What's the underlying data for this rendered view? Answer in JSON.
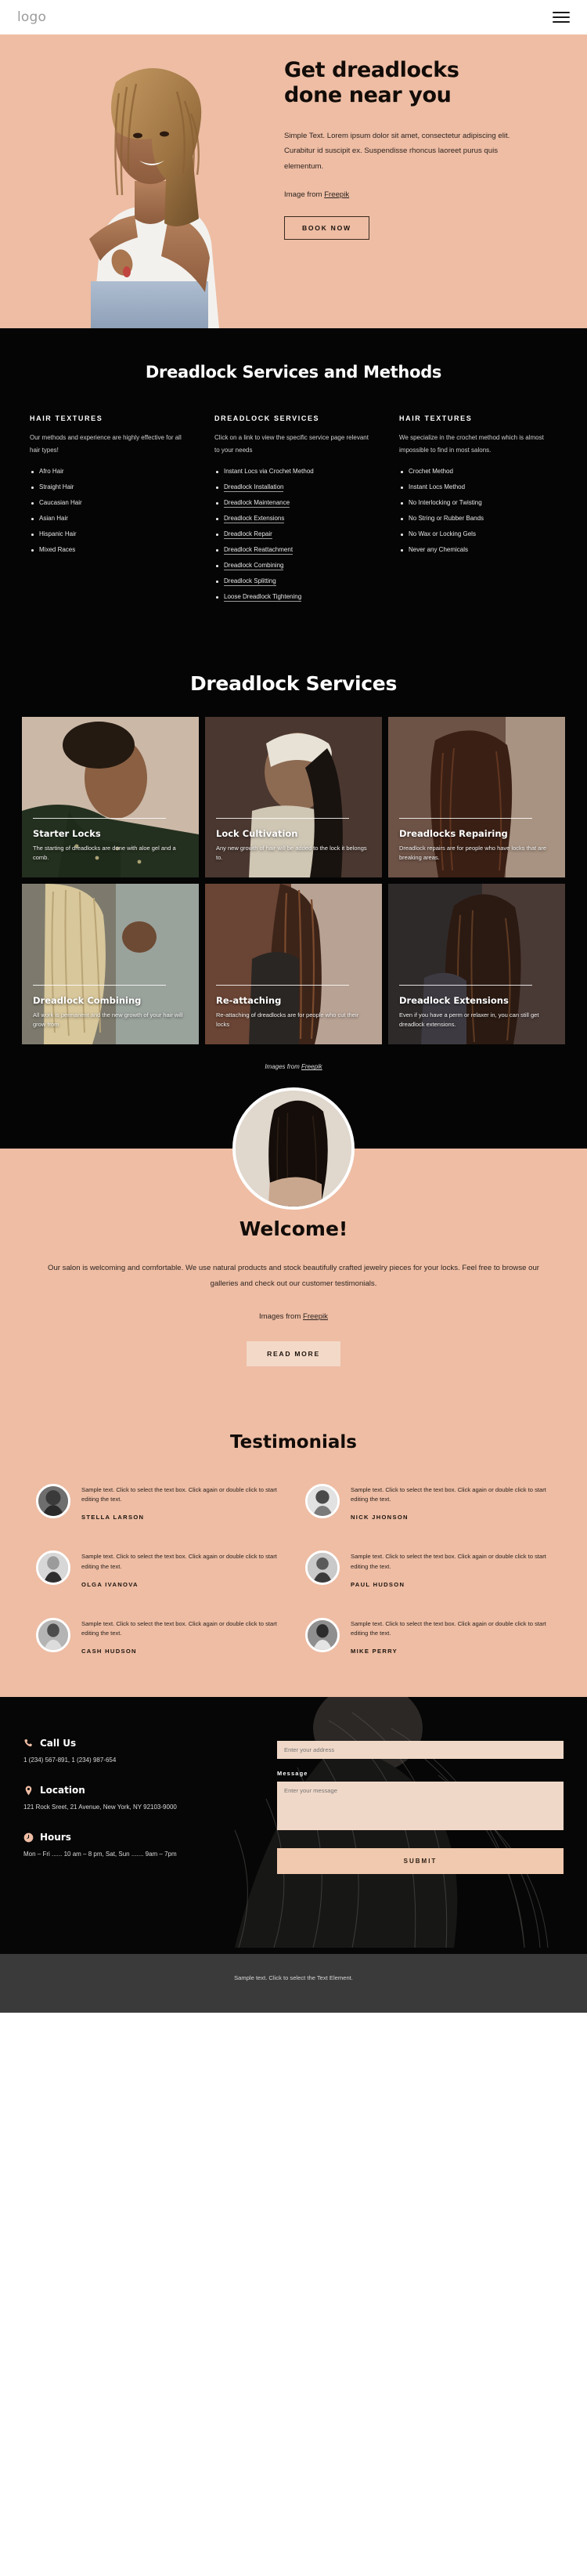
{
  "header": {
    "logo": "logo",
    "menu_icon": "hamburger-menu-icon"
  },
  "hero": {
    "title_line1": "Get dreadlocks",
    "title_line2": "done near you",
    "description": "Simple Text. Lorem ipsum dolor sit amet, consectetur adipiscing elit. Curabitur id suscipit ex. Suspendisse rhoncus laoreet purus quis elementum.",
    "credit_prefix": "Image from ",
    "credit_link": "Freepik",
    "cta": "BOOK NOW"
  },
  "methods": {
    "title": "Dreadlock Services and Methods",
    "columns": [
      {
        "heading": "HAIR TEXTURES",
        "paragraph": "Our methods and experience are highly effective for all hair types!",
        "items": [
          {
            "label": "Afro Hair",
            "link": false
          },
          {
            "label": "Straight Hair",
            "link": false
          },
          {
            "label": "Caucasian Hair",
            "link": false
          },
          {
            "label": "Asian Hair",
            "link": false
          },
          {
            "label": "Hispanic Hair",
            "link": false
          },
          {
            "label": "Mixed Races",
            "link": false
          }
        ]
      },
      {
        "heading": "DREADLOCK SERVICES",
        "paragraph": "Click on a link to view the specific service page relevant to your needs",
        "items": [
          {
            "label": "Instant Locs via Crochet Method",
            "link": false
          },
          {
            "label": "Dreadlock Installation",
            "link": true
          },
          {
            "label": "Dreadlock Maintenance",
            "link": true
          },
          {
            "label": "Dreadlock Extensions",
            "link": true
          },
          {
            "label": "Dreadlock Repair",
            "link": true
          },
          {
            "label": "Dreadlock Reattachment",
            "link": true
          },
          {
            "label": "Dreadlock Combining",
            "link": true
          },
          {
            "label": "Dreadlock Splitting",
            "link": true
          },
          {
            "label": "Loose Dreadlock Tightening",
            "link": true
          }
        ]
      },
      {
        "heading": "HAIR TEXTURES",
        "paragraph": "We specialize in the crochet method which is almost impossible to find in most salons.",
        "items": [
          {
            "label": "Crochet Method",
            "link": false
          },
          {
            "label": "Instant Locs Method",
            "link": false
          },
          {
            "label": "No Interlocking or Twisting",
            "link": false
          },
          {
            "label": "No String or Rubber Bands",
            "link": false
          },
          {
            "label": "No Wax or Locking Gels",
            "link": false
          },
          {
            "label": "Never any Chemicals",
            "link": false
          }
        ]
      }
    ]
  },
  "gallery": {
    "title": "Dreadlock Services",
    "credit_prefix": "Images from ",
    "credit_link": "Freepik",
    "cards": [
      {
        "title": "Starter Locks",
        "text": "The starting of dreadlocks are done with aloe gel and a comb."
      },
      {
        "title": "Lock Cultivation",
        "text": "Any new growth of hair will be added to the lock it belongs to."
      },
      {
        "title": "Dreadlocks Repairing",
        "text": "Dreadlock repairs are for people who have locks that are breaking areas."
      },
      {
        "title": "Dreadlock Combining",
        "text": "All work is permanent and the new growth of your hair will grow from"
      },
      {
        "title": "Re-attaching",
        "text": "Re-attaching of dreadlocks are for people who cut their locks"
      },
      {
        "title": "Dreadlock Extensions",
        "text": "Even if you have a perm or relaxer in, you can still get dreadlock extensions."
      }
    ]
  },
  "welcome": {
    "heading": "Welcome!",
    "paragraph": "Our salon is welcoming and comfortable. We use natural products and stock beautifully crafted jewelry pieces for your locks. Feel free to browse our galleries and check out our customer testimonials.",
    "credit_prefix": "Images from ",
    "credit_link": "Freepik",
    "cta": "READ MORE"
  },
  "testimonials": {
    "title": "Testimonials",
    "items": [
      {
        "text": "Sample text. Click to select the text box. Click again or double click to start editing the text.",
        "name": "STELLA LARSON"
      },
      {
        "text": "Sample text. Click to select the text box. Click again or double click to start editing the text.",
        "name": "NICK JHONSON"
      },
      {
        "text": "Sample text. Click to select the text box. Click again or double click to start editing the text.",
        "name": "OLGA IVANOVA"
      },
      {
        "text": "Sample text. Click to select the text box. Click again or double click to start editing the text.",
        "name": "PAUL HUDSON"
      },
      {
        "text": "Sample text. Click to select the text box. Click again or double click to start editing the text.",
        "name": "CASH HUDSON"
      },
      {
        "text": "Sample text. Click to select the text box. Click again or double click to start editing the text.",
        "name": "MIKE PERRY"
      }
    ]
  },
  "contact": {
    "call": {
      "icon": "phone-icon",
      "title": "Call Us",
      "value": "1 (234) 567-891, 1 (234) 987-654"
    },
    "location": {
      "icon": "map-pin-icon",
      "title": "Location",
      "value": "121 Rock Sreet, 21 Avenue, New York, NY 92103-9000"
    },
    "hours": {
      "icon": "clock-icon",
      "title": "Hours",
      "value": "Mon – Fri ...... 10 am – 8 pm, Sat, Sun ....... 9am – 7pm"
    },
    "form": {
      "address_placeholder": "Enter your address",
      "address_value": "",
      "message_label": "Message",
      "message_placeholder": "Enter your message",
      "message_value": "",
      "submit": "SUBMIT"
    }
  },
  "footer": {
    "text": "Sample text. Click to select the Text Element."
  },
  "colors": {
    "accent": "#eebda4",
    "dark": "#050505",
    "button": "#f0c9ae"
  }
}
